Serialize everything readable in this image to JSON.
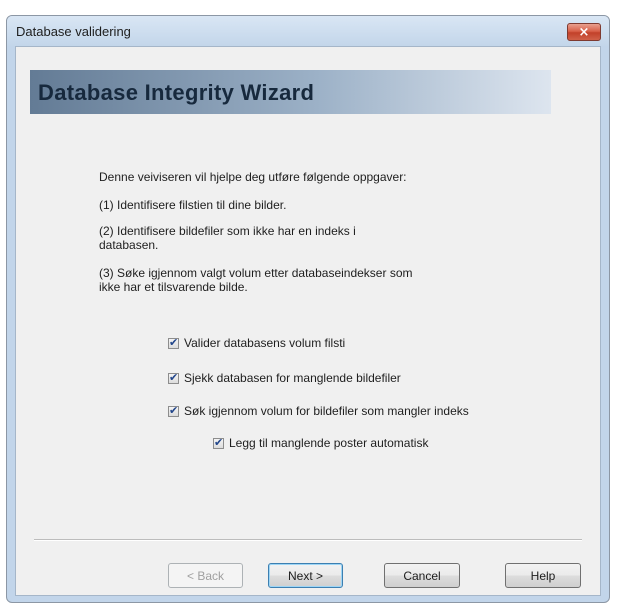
{
  "window": {
    "title": "Database validering",
    "close_glyph": "×"
  },
  "banner": {
    "title": "Database Integrity Wizard"
  },
  "intro": {
    "lead": "Denne veiviseren vil hjelpe deg utføre følgende oppgaver:",
    "task1": "(1) Identifisere filstien til dine bilder.",
    "task2_line1": "(2) Identifisere bildefiler som ikke har en indeks i",
    "task2_line2": "databasen.",
    "task3_line1": "(3) Søke igjennom valgt volum etter databaseindekser som",
    "task3_line2": "ikke har et tilsvarende bilde."
  },
  "options": [
    {
      "label": "Valider databasens volum filsti",
      "checked": true
    },
    {
      "label": "Sjekk databasen for manglende bildefiler",
      "checked": true
    },
    {
      "label": "Søk igjennom volum for bildefiler som mangler indeks",
      "checked": true
    },
    {
      "label": "Legg til manglende poster automatisk",
      "checked": true
    }
  ],
  "buttons": {
    "back": "< Back",
    "next": "Next >",
    "cancel": "Cancel",
    "help": "Help"
  }
}
